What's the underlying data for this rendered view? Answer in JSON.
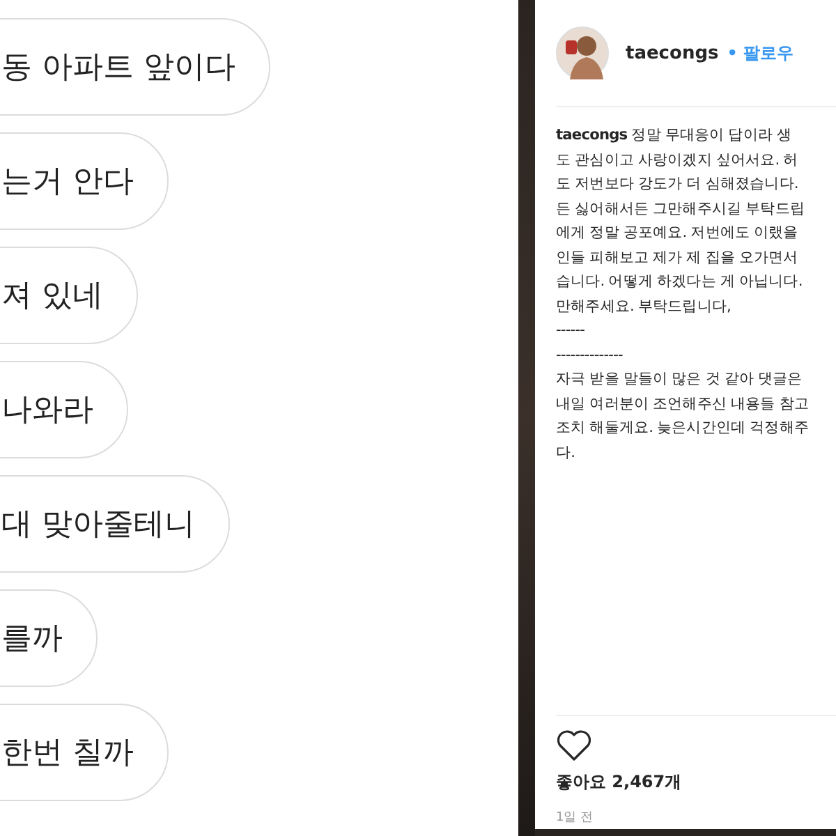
{
  "chat": {
    "bubbles": [
      {
        "text": "동 아파트 앞이다"
      },
      {
        "text": "는거 안다"
      },
      {
        "text": "져 있네"
      },
      {
        "text": "나와라"
      },
      {
        "text": "대 맞아줄테니"
      },
      {
        "text": "를까"
      },
      {
        "text": "한번 칠까"
      }
    ]
  },
  "post": {
    "username": "taecongs",
    "follow": "• 팔로우",
    "caption_lines": [
      "**taecongs** 정말 무대응이 답이라 생",
      "도 관심이고 사랑이겠지 싶어서요. 허",
      "도 저번보다 강도가 더 심해졌습니다.",
      "든 싫어해서든 그만해주시길 부탁드립",
      "에게 정말 공포예요. 저번에도 이랬을",
      "인들 피해보고 제가 제 집을 오가면서",
      "습니다. 어떻게 하겠다는 게 아닙니다.",
      "만해주세요. 부탁드립니다,",
      "------",
      "--------------",
      "자극 받을 말들이 많은 것 같아 댓글은",
      "내일 여러분이 조언해주신 내용들 참고",
      "조치 해둘게요. 늦은시간인데 걱정해주",
      "다."
    ],
    "likes": "좋아요 2,467개",
    "time": "1일 전"
  }
}
